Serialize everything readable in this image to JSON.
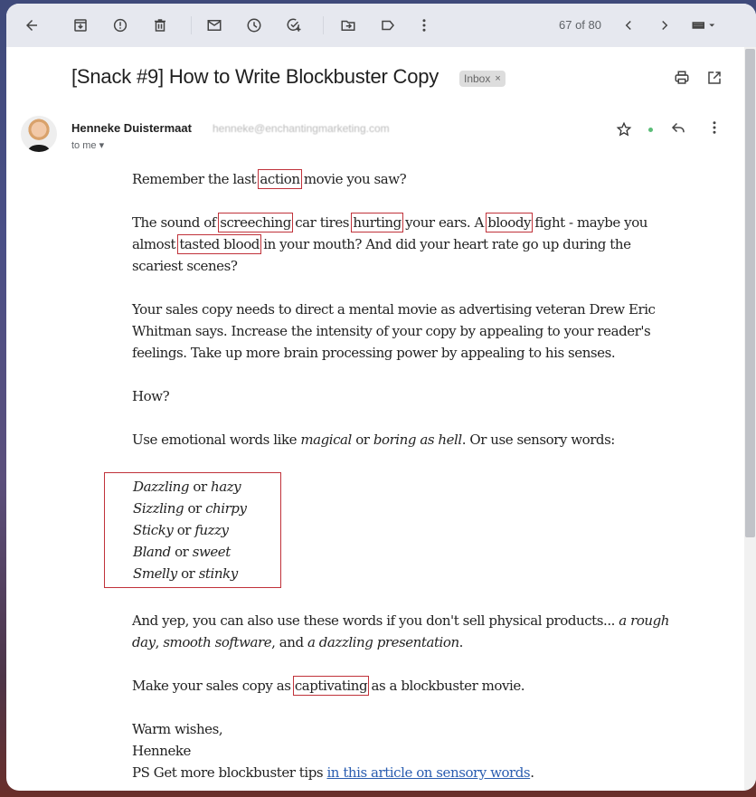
{
  "toolbar": {
    "icons": [
      {
        "name": "back-arrow-icon",
        "label": "Back"
      },
      {
        "name": "archive-icon",
        "label": "Archive"
      },
      {
        "name": "report-spam-icon",
        "label": "Report spam"
      },
      {
        "name": "delete-icon",
        "label": "Delete"
      },
      {
        "name": "mark-unread-icon",
        "label": "Mark as unread"
      },
      {
        "name": "snooze-icon",
        "label": "Snooze"
      },
      {
        "name": "add-task-icon",
        "label": "Add to Tasks"
      },
      {
        "name": "move-to-icon",
        "label": "Move to"
      },
      {
        "name": "label-icon",
        "label": "Labels"
      },
      {
        "name": "more-vert-icon",
        "label": "More"
      }
    ],
    "counter": "67 of 80",
    "prev_label": "Newer",
    "next_label": "Older",
    "keyboard_label": "Input tools"
  },
  "email": {
    "subject": "[Snack #9] How to Write Blockbuster Copy",
    "label_chip": "Inbox",
    "label_chip_close": "×",
    "sender_name": "Henneke Duistermaat",
    "sender_email": "henneke@enchantingmarketing.com",
    "recipient": "to me ▾",
    "status_color": "#5bbd78"
  },
  "body": {
    "p1": {
      "a": "Remember the last ",
      "h1": "action",
      "b": " movie you saw?"
    },
    "p2": {
      "a": "The sound of ",
      "h1": "screeching",
      "b": " car tires ",
      "h2": "hurting",
      "c": " your ears. A ",
      "h3": "bloody",
      "d": " fight - maybe you almost ",
      "h4": "tasted blood",
      "e": " in your mouth? And did your heart rate go up during the scariest scenes?"
    },
    "p3": "Your sales copy needs to direct a mental movie as advertising veteran Drew Eric Whitman says. Increase the intensity of your copy by appealing to your reader's feelings. Take up more brain processing power by appealing to his senses.",
    "p4": "How?",
    "p5": {
      "a": "Use emotional words like ",
      "i1": "magical",
      "b": " or ",
      "i2": "boring as hell",
      "c": ". Or use sensory words:"
    },
    "pairs": [
      {
        "w1": "Dazzling",
        "or": " or ",
        "w2": "hazy"
      },
      {
        "w1": "Sizzling",
        "or": " or ",
        "w2": "chirpy"
      },
      {
        "w1": "Sticky",
        "or": " or ",
        "w2": "fuzzy"
      },
      {
        "w1": "Bland",
        "or": " or ",
        "w2": "sweet"
      },
      {
        "w1": "Smelly",
        "or": " or ",
        "w2": "stinky"
      }
    ],
    "p6": {
      "a": "And yep, you can also use these words if you don't sell physical products... ",
      "i1": "a rough day",
      "b": ", ",
      "i2": "smooth software",
      "c": ", and ",
      "i3": "a dazzling presentation",
      "d": "."
    },
    "p7": {
      "a": "Make your sales copy as ",
      "h1": "captivating",
      "b": " as a blockbuster movie."
    },
    "signoff": "Warm wishes,",
    "signature": "Henneke",
    "ps": {
      "a": "PS Get more blockbuster tips ",
      "link": "in this article on sensory words",
      "b": "."
    }
  }
}
